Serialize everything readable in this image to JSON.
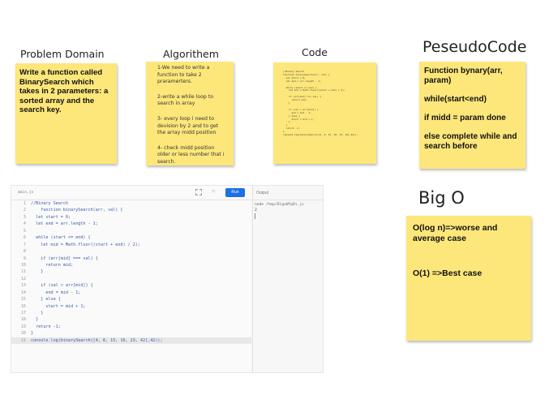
{
  "headings": {
    "problem_domain": "Problem Domain",
    "algorithm": "Algorithem",
    "code": "Code",
    "pseudocode": "PeseudoCode",
    "big_o": "Big O"
  },
  "problem_note": {
    "text": "Write a function called BinarySearch which takes in 2 parameters: a sorted array and the search key."
  },
  "algorithm_note": {
    "steps": [
      "1-We need to write a function to take 2 praramerters.",
      "2-write a while loop to search in array",
      "3- every loop i need to devision by 2 and to get the array midd position",
      "4- check midd position older or less number that i search."
    ]
  },
  "code_note": {
    "lines": [
      "//Binary Search",
      "function binarySearch(arr, val) {",
      "  let start = 0;",
      "  let end = arr.length - 1;",
      "",
      "  while (start <= end) {",
      "    let mid = Math.floor((start + end) / 2);",
      "",
      "    if (arr[mid] === val) {",
      "      return mid;",
      "    }",
      "",
      "    if (val < arr[mid]) {",
      "      end = mid - 1;",
      "    } else {",
      "      start = mid + 1;",
      "    }",
      "  }",
      "  return -1;",
      "}",
      "console.log(binarySearch([4, 8, 15, 16, 23, 42],42));"
    ]
  },
  "pseudocode_note": {
    "paragraphs": [
      "Function bynary(arr, param)",
      "while(start<end)",
      "if midd = param done",
      "else complete while and search before"
    ]
  },
  "bigo_note": {
    "worst": "O(log n)=>worse and average case",
    "best": "O(1) =>Best case"
  },
  "editor": {
    "file_tab": "main.js",
    "run_label": "Run",
    "output_label": "Output",
    "output_command": "node /tmp/6lgvWfpDi.js",
    "output_result": "2",
    "lines": [
      {
        "n": "1",
        "t": "//Binary Search"
      },
      {
        "n": "2",
        "t": "    function binarySearch(arr, val) {"
      },
      {
        "n": "3",
        "t": "  let start = 0;"
      },
      {
        "n": "4",
        "t": "  let end = arr.length - 1;"
      },
      {
        "n": "5",
        "t": ""
      },
      {
        "n": "6",
        "t": "  while (start <= end) {"
      },
      {
        "n": "7",
        "t": "    let mid = Math.floor((start + end) / 2);"
      },
      {
        "n": "8",
        "t": ""
      },
      {
        "n": "9",
        "t": "    if (arr[mid] === val) {"
      },
      {
        "n": "10",
        "t": "      return mid;"
      },
      {
        "n": "11",
        "t": "    }"
      },
      {
        "n": "12",
        "t": ""
      },
      {
        "n": "13",
        "t": "    if (val < arr[mid]) {"
      },
      {
        "n": "14",
        "t": "      end = mid - 1;"
      },
      {
        "n": "15",
        "t": "    } else {"
      },
      {
        "n": "16",
        "t": "      start = mid + 1;"
      },
      {
        "n": "17",
        "t": "    }"
      },
      {
        "n": "18",
        "t": "  }"
      },
      {
        "n": "19",
        "t": "  return -1;"
      },
      {
        "n": "20",
        "t": "}"
      },
      {
        "n": "21",
        "t": "console.log(binarySearch([4, 8, 15, 16, 23, 42],42));"
      }
    ]
  },
  "colors": {
    "note_yellow": "#fde77a",
    "run_button": "#1c6fe8"
  }
}
